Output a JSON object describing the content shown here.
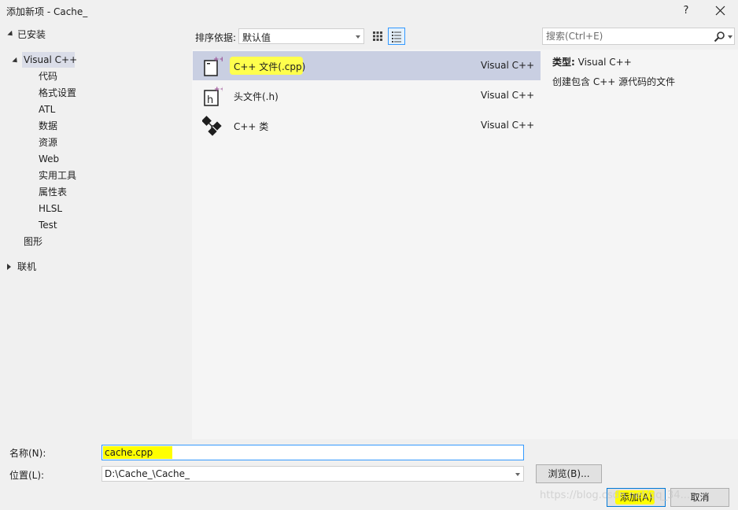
{
  "window": {
    "title": "添加新项 - Cache_",
    "help_label": "?"
  },
  "tree": {
    "installed_label": "已安装",
    "visual_cpp_label": "Visual C++",
    "children": [
      "代码",
      "格式设置",
      "ATL",
      "数据",
      "资源",
      "Web",
      "实用工具",
      "属性表",
      "HLSL",
      "Test"
    ],
    "graphics_label": "图形",
    "online_label": "联机"
  },
  "sort": {
    "label": "排序依据:",
    "value": "默认值"
  },
  "search": {
    "placeholder": "搜索(Ctrl+E)"
  },
  "templates": [
    {
      "name": "C++ 文件(.cpp)",
      "lang": "Visual C++",
      "icon": "cpp-file-icon"
    },
    {
      "name": "头文件(.h)",
      "lang": "Visual C++",
      "icon": "header-file-icon"
    },
    {
      "name": "C++ 类",
      "lang": "Visual C++",
      "icon": "cpp-class-icon"
    }
  ],
  "details": {
    "type_label": "类型:",
    "type_value": "Visual C++",
    "description": "创建包含 C++ 源代码的文件"
  },
  "form": {
    "name_label": "名称(N):",
    "name_value": "cache.cpp",
    "location_label": "位置(L):",
    "location_value": "D:\\Cache_\\Cache_",
    "browse_label": "浏览(B)...",
    "add_label": "添加(A)",
    "cancel_label": "取消"
  },
  "watermark": "https://blog.csdn.net/qq_34..."
}
